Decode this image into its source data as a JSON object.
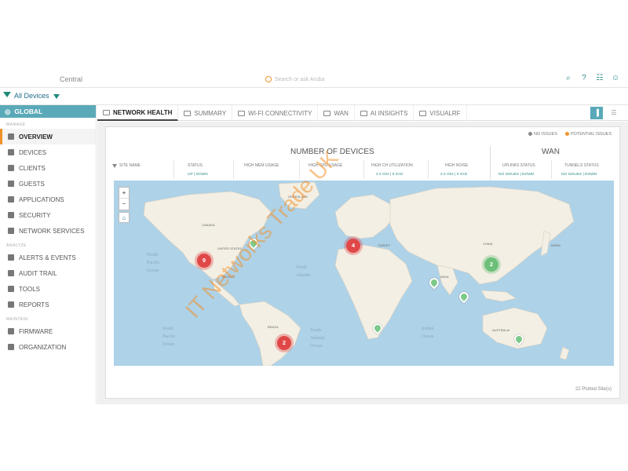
{
  "app": {
    "title": "Central"
  },
  "search": {
    "placeholder": "Search or ask Aruba"
  },
  "filter": {
    "label": "All Devices"
  },
  "sidebar": {
    "global_label": "GLOBAL",
    "sections": [
      {
        "title": "MANAGE",
        "items": [
          {
            "label": "OVERVIEW",
            "icon": "grid-icon",
            "active": true
          },
          {
            "label": "DEVICES",
            "icon": "devices-icon"
          },
          {
            "label": "CLIENTS",
            "icon": "clients-icon"
          },
          {
            "label": "GUESTS",
            "icon": "guests-icon"
          },
          {
            "label": "APPLICATIONS",
            "icon": "applications-icon"
          },
          {
            "label": "SECURITY",
            "icon": "security-icon"
          },
          {
            "label": "NETWORK SERVICES",
            "icon": "network-services-icon"
          }
        ]
      },
      {
        "title": "ANALYZE",
        "items": [
          {
            "label": "ALERTS & EVENTS",
            "icon": "alerts-icon"
          },
          {
            "label": "AUDIT TRAIL",
            "icon": "audit-icon"
          },
          {
            "label": "TOOLS",
            "icon": "tools-icon"
          },
          {
            "label": "REPORTS",
            "icon": "reports-icon"
          }
        ]
      },
      {
        "title": "MAINTAIN",
        "items": [
          {
            "label": "FIRMWARE",
            "icon": "firmware-icon"
          },
          {
            "label": "ORGANIZATION",
            "icon": "organization-icon"
          }
        ]
      }
    ]
  },
  "tabs": [
    {
      "label": "NETWORK HEALTH",
      "active": true
    },
    {
      "label": "SUMMARY"
    },
    {
      "label": "WI-FI CONNECTIVITY"
    },
    {
      "label": "WAN"
    },
    {
      "label": "AI INSIGHTS"
    },
    {
      "label": "VISUALRF"
    }
  ],
  "legend": {
    "no_issues": "NO ISSUES",
    "potential_issues": "POTENTIAL ISSUES"
  },
  "headers": {
    "devices": "NUMBER OF DEVICES",
    "wan": "WAN"
  },
  "columns": {
    "site_name": "SITE NAME",
    "status": "STATUS",
    "status_sub": "UP | DOWN",
    "mem": "HIGH MEM USAGE",
    "cpu": "HIGH CPU USAGE",
    "ch_util": "HIGH CH UTILIZATION",
    "ch_util_sub": "2.4 Ghz | 5 GHz",
    "noise": "HIGH NOISE",
    "noise_sub": "2.4 Ghz | 5 GHz",
    "uplinks": "UPLINKS STATUS",
    "uplinks_sub": "NO ISSUES | DOWN",
    "tunnels": "TUNNELS STATUS",
    "tunnels_sub": "NO ISSUES | DOWN"
  },
  "map": {
    "clusters": [
      {
        "count": "9",
        "status": "issue"
      },
      {
        "count": "4",
        "status": "issue"
      },
      {
        "count": "2",
        "status": "issue"
      },
      {
        "count": "2",
        "status": "ok"
      }
    ],
    "oceans": [
      "North Pacific Ocean",
      "South Pacific Ocean",
      "North Atlantic Ocean",
      "South Atlantic Ocean",
      "Indian Ocean"
    ],
    "countries": [
      "UNITED STATES",
      "GREENLAND",
      "CANADA",
      "MEXICO",
      "BRAZIL",
      "AUSTRALIA",
      "JAPAN",
      "INDIA",
      "CHINA",
      "TURKEY"
    ]
  },
  "footer": {
    "plotted": "22 Plotted Site(s)"
  },
  "watermark": "IT Networks Trade UK"
}
